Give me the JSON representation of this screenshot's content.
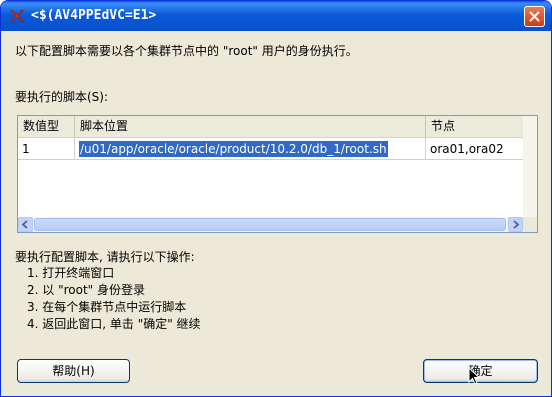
{
  "window": {
    "title": "<$(AV4PPEdVC=E1>",
    "close_label": "×"
  },
  "dialog": {
    "intro": "以下配置脚本需要以各个集群节点中的 \"root\" 用户的身份执行。",
    "scripts_label": "要执行的脚本(S):",
    "table": {
      "headers": [
        "数值型",
        "脚本位置",
        "节点"
      ],
      "rows": [
        {
          "number": "1",
          "location": "/u01/app/oracle/oracle/product/10.2.0/db_1/root.sh",
          "nodes": "ora01,ora02"
        }
      ]
    },
    "instructions_title": "要执行配置脚本, 请执行以下操作:",
    "steps": [
      "1. 打开终端窗口",
      "2. 以 \"root\" 身份登录",
      "3. 在每个集群节点中运行脚本",
      "4. 返回此窗口, 单击 \"确定\" 继续"
    ],
    "help_button": "帮助(H)",
    "ok_button": "确定"
  }
}
